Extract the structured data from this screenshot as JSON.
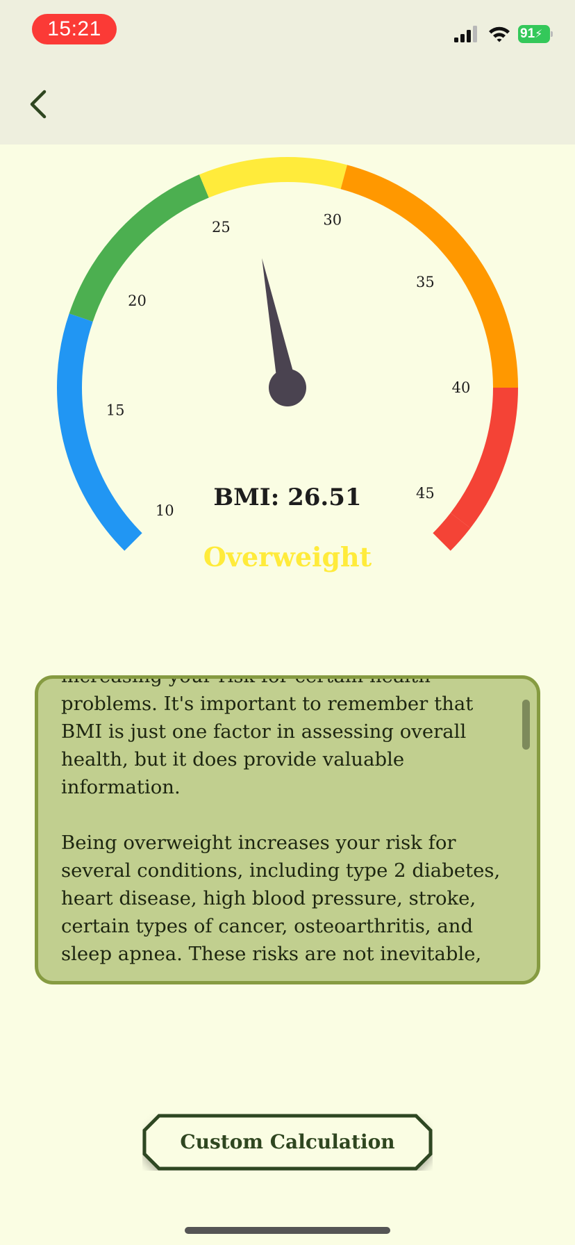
{
  "status_bar": {
    "time": "15:21",
    "battery": "91"
  },
  "gauge": {
    "labels": [
      "10",
      "15",
      "20",
      "25",
      "30",
      "35",
      "40",
      "45"
    ],
    "needle_value": 26.51,
    "colors": {
      "underweight": "#2196f3",
      "normal": "#4caf50",
      "overweight": "#ffeb3b",
      "obese": "#ff9800",
      "severe": "#f44336",
      "needle": "#4a4350"
    }
  },
  "result": {
    "bmi_text": "BMI: 26.51",
    "category": "Overweight",
    "category_color": "#ffeb3b"
  },
  "info": {
    "paragraphs": [
      "increasing your risk for certain health problems.  It's important to remember that BMI is just one factor in assessing overall health, but it does provide valuable information.",
      "Being overweight increases your risk for several conditions, including type 2 diabetes, heart disease, high blood pressure, stroke, certain types of cancer, osteoarthritis, and sleep apnea.  These risks are not inevitable,"
    ]
  },
  "button": {
    "label": "Custom Calculation"
  }
}
